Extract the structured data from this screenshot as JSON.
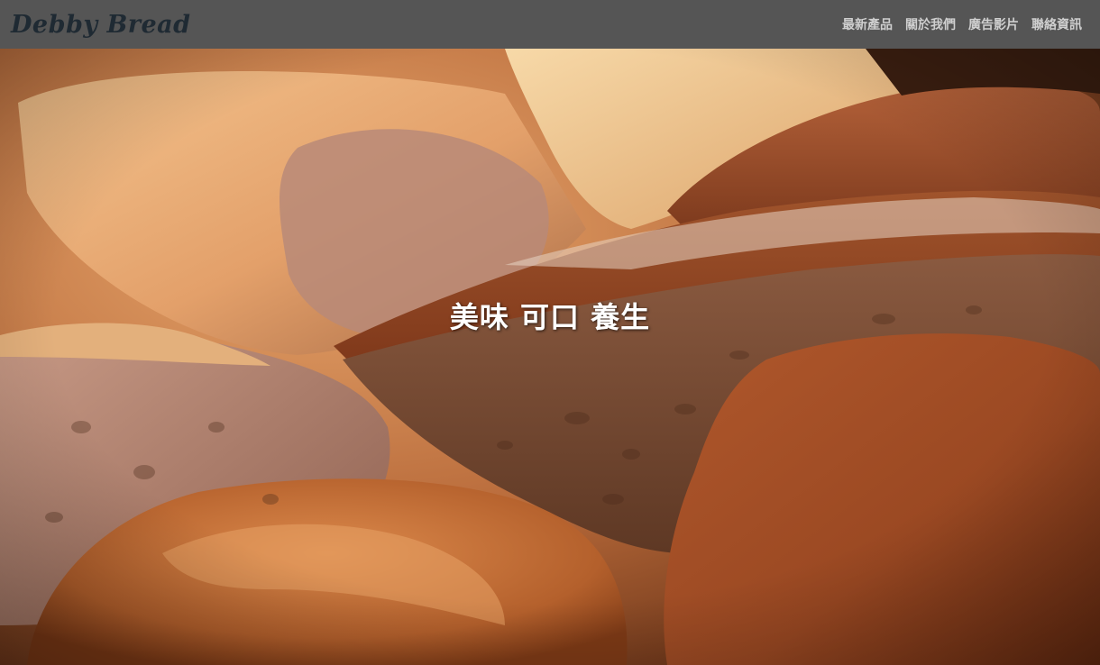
{
  "navbar": {
    "brand": "Debby Bread",
    "background": "#555555",
    "links": [
      {
        "label": "最新產品"
      },
      {
        "label": "關於我們"
      },
      {
        "label": "廣告影片"
      },
      {
        "label": "聯絡資訊"
      }
    ]
  },
  "hero": {
    "title": "美味 可口 養生",
    "image_subject": "sliced rustic bread loaves"
  },
  "colors": {
    "nav_text": "#cfcfcf",
    "brand_text": "#1f2a33",
    "hero_text": "#ffffff"
  }
}
